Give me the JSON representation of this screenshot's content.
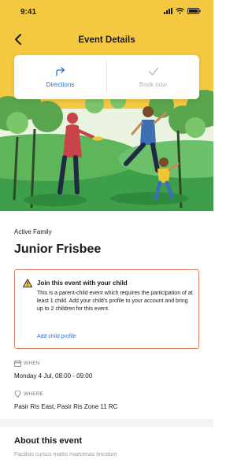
{
  "status_bar": {
    "time": "9:41"
  },
  "nav": {
    "title": "Event Details"
  },
  "actions": {
    "directions_label": "Directions",
    "book_label": "Book now"
  },
  "event": {
    "category": "Active Family",
    "title": "Junior Frisbee"
  },
  "alert": {
    "title": "Join this event with your child",
    "body": "This is a parent-child event which requires the participation of at least 1 child. Add your child's profile to your account and bring up to 2 children for this event.",
    "link": "Add child profile"
  },
  "when": {
    "label": "WHEN",
    "value": "Monday 4 Jul, 08:00 - 09:00"
  },
  "where": {
    "label": "WHERE",
    "value": "Pasir Ris East, Pasir Ris Zone 11 RC"
  },
  "about": {
    "title": "About this event",
    "body": "Facilisis cursus mattis maecenas tincidunt"
  },
  "colors": {
    "header": "#f5c842",
    "accent": "#2f6fcf",
    "alert_border": "#e07a5f"
  }
}
